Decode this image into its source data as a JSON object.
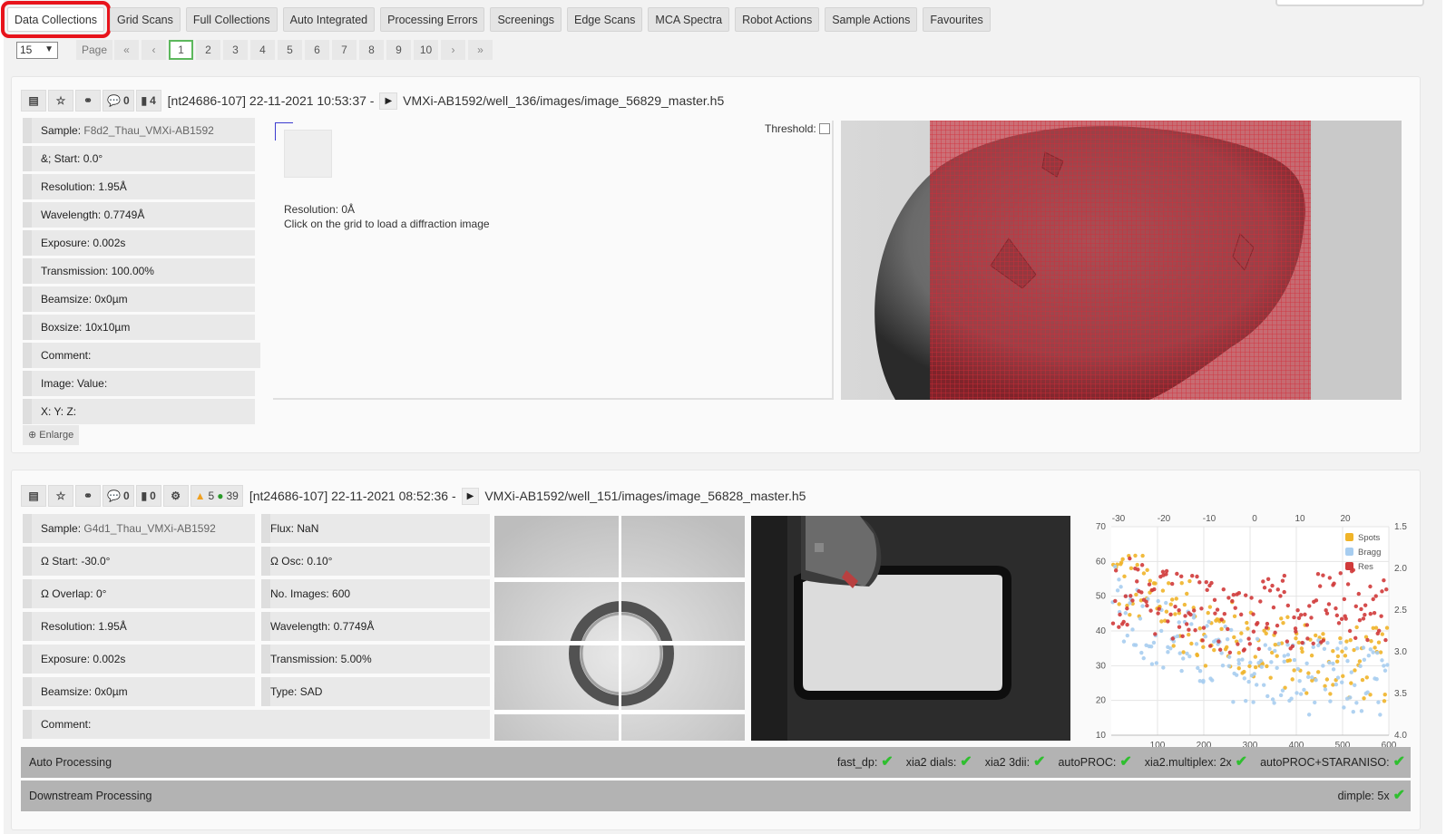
{
  "tabs": [
    "Data Collections",
    "Grid Scans",
    "Full Collections",
    "Auto Integrated",
    "Processing Errors",
    "Screenings",
    "Edge Scans",
    "MCA Spectra",
    "Robot Actions",
    "Sample Actions",
    "Favourites"
  ],
  "pager": {
    "per_page": "15",
    "page_label": "Page",
    "first": "«",
    "prev": "‹",
    "next": "›",
    "last": "»",
    "current": "1",
    "pages": [
      "2",
      "3",
      "4",
      "5",
      "6",
      "7",
      "8",
      "9",
      "10"
    ]
  },
  "panel1": {
    "comments": "0",
    "files": "4",
    "proposal_date": "[nt24686-107] 22-11-2021 10:53:37 -",
    "path": "VMXi-AB1592/well_136/images/image_56829_master.h5",
    "info": [
      {
        "label": "Sample:",
        "value": "F8d2_Thau_VMXi-AB1592"
      },
      {
        "label": "&; Start:",
        "value": "0.0°"
      },
      {
        "label": "Resolution:",
        "value": "1.95Å"
      },
      {
        "label": "Wavelength:",
        "value": "0.7749Å"
      },
      {
        "label": "Exposure:",
        "value": "0.002s"
      },
      {
        "label": "Transmission:",
        "value": "100.00%"
      },
      {
        "label": "Beamsize:",
        "value": "0x0µm"
      },
      {
        "label": "Boxsize:",
        "value": "10x10µm"
      },
      {
        "label": "Comment:",
        "value": ""
      },
      {
        "label": "Image: Value:",
        "value": ""
      },
      {
        "label": "X: Y: Z:",
        "value": ""
      }
    ],
    "enlarge": "Enlarge",
    "resolution": "Resolution: 0Å",
    "hint": "Click on the grid to load a diffraction image",
    "threshold_label": "Threshold:",
    "metric": "pia_estimated_d_min"
  },
  "panel2": {
    "comments": "0",
    "files": "0",
    "warnings": "5",
    "infos": "39",
    "proposal_date": "[nt24686-107] 22-11-2021 08:52:36 -",
    "path": "VMXi-AB1592/well_151/images/image_56828_master.h5",
    "info_left": [
      {
        "label": "Sample:",
        "value": "G4d1_Thau_VMXi-AB1592"
      },
      {
        "label": "Ω Start:",
        "value": "-30.0°"
      },
      {
        "label": "Ω Overlap:",
        "value": "0°"
      },
      {
        "label": "Resolution:",
        "value": "1.95Å"
      },
      {
        "label": "Exposure:",
        "value": "0.002s"
      },
      {
        "label": "Beamsize:",
        "value": "0x0µm"
      }
    ],
    "info_right": [
      {
        "label": "Flux:",
        "value": "NaN"
      },
      {
        "label": "Ω Osc:",
        "value": "0.10°"
      },
      {
        "label": "No. Images:",
        "value": "600"
      },
      {
        "label": "Wavelength:",
        "value": "0.7749Å"
      },
      {
        "label": "Transmission:",
        "value": "5.00%"
      },
      {
        "label": "Type:",
        "value": "SAD"
      }
    ],
    "comment_label": "Comment:",
    "auto_processing": {
      "label": "Auto Processing",
      "items": [
        "fast_dp:",
        "xia2 dials:",
        "xia2 3dii:",
        "autoPROC:",
        "xia2.multiplex: 2x",
        "autoPROC+STARANISO:"
      ]
    },
    "downstream": {
      "label": "Downstream Processing",
      "items": [
        "dimple: 5x"
      ]
    }
  },
  "chart_data": {
    "type": "scatter",
    "x_top_ticks": [
      "-30",
      "-20",
      "-10",
      "0",
      "10",
      "20"
    ],
    "x_bottom_ticks": [
      "100",
      "200",
      "300",
      "400",
      "500",
      "600"
    ],
    "y_left_ticks": [
      "70",
      "60",
      "50",
      "40",
      "30",
      "20",
      "10"
    ],
    "y_right_ticks": [
      "1.5",
      "2.0",
      "2.5",
      "3.0",
      "3.5",
      "4.0"
    ],
    "xlim": [
      0,
      600
    ],
    "ylim": [
      10,
      70
    ],
    "y2lim": [
      1.5,
      4.0
    ],
    "legend_position": "top-right",
    "series": [
      {
        "name": "Spots",
        "color": "#f0b429",
        "axis": "left",
        "trend": [
          [
            0,
            56
          ],
          [
            100,
            49
          ],
          [
            200,
            41
          ],
          [
            300,
            36
          ],
          [
            400,
            33
          ],
          [
            500,
            31
          ],
          [
            600,
            30
          ]
        ]
      },
      {
        "name": "Bragg",
        "color": "#a7cdf0",
        "axis": "left",
        "trend": [
          [
            0,
            50
          ],
          [
            100,
            40
          ],
          [
            200,
            33
          ],
          [
            300,
            29
          ],
          [
            400,
            27
          ],
          [
            500,
            26
          ],
          [
            600,
            25
          ]
        ]
      },
      {
        "name": "Res",
        "color": "#d03a3a",
        "axis": "right",
        "trend": [
          [
            0,
            2.25
          ],
          [
            100,
            2.45
          ],
          [
            200,
            2.55
          ],
          [
            300,
            2.6
          ],
          [
            400,
            2.5
          ],
          [
            500,
            2.45
          ],
          [
            600,
            2.5
          ]
        ]
      }
    ]
  }
}
